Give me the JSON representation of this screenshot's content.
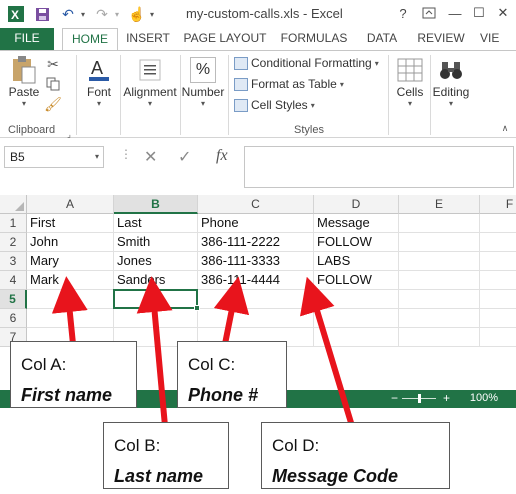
{
  "app": {
    "window_title": "my-custom-calls.xls - Excel",
    "help": "?"
  },
  "ribbon_tabs": [
    "FILE",
    "HOME",
    "INSERT",
    "PAGE LAYOUT",
    "FORMULAS",
    "DATA",
    "REVIEW",
    "VIE"
  ],
  "ribbon": {
    "paste": "Paste",
    "clipboard": "Clipboard",
    "font": "Font",
    "alignment": "Alignment",
    "number": "Number",
    "number_symbol": "%",
    "conditional_formatting": "Conditional Formatting",
    "format_as_table": "Format as Table",
    "cell_styles": "Cell Styles",
    "styles": "Styles",
    "cells": "Cells",
    "editing": "Editing"
  },
  "formula_bar": {
    "name_box": "B5",
    "fx": "fx",
    "cancel": "✕",
    "enter": "✓",
    "value": ""
  },
  "grid": {
    "columns": [
      "A",
      "B",
      "C",
      "D",
      "E",
      "F"
    ],
    "rows": [
      "1",
      "2",
      "3",
      "4",
      "5",
      "6",
      "7"
    ],
    "cells": [
      [
        "First",
        "Last",
        "Phone",
        "Message"
      ],
      [
        "John",
        "Smith",
        "386-111-2222",
        "FOLLOW"
      ],
      [
        "Mary",
        "Jones",
        "386-111-3333",
        "LABS"
      ],
      [
        "Mark",
        "Sanders",
        "386-111-4444",
        "FOLLOW"
      ]
    ],
    "selected_cell": "B5"
  },
  "status": {
    "zoom": "100%"
  },
  "callouts": [
    {
      "line1": "Col A:",
      "line2": "First name"
    },
    {
      "line1": "Col B:",
      "line2": "Last name"
    },
    {
      "line1": "Col C:",
      "line2": "Phone #"
    },
    {
      "line1": "Col D:",
      "line2": "Message Code"
    }
  ],
  "colors": {
    "excel_green": "#217346",
    "arrow_red": "#e8141c"
  }
}
